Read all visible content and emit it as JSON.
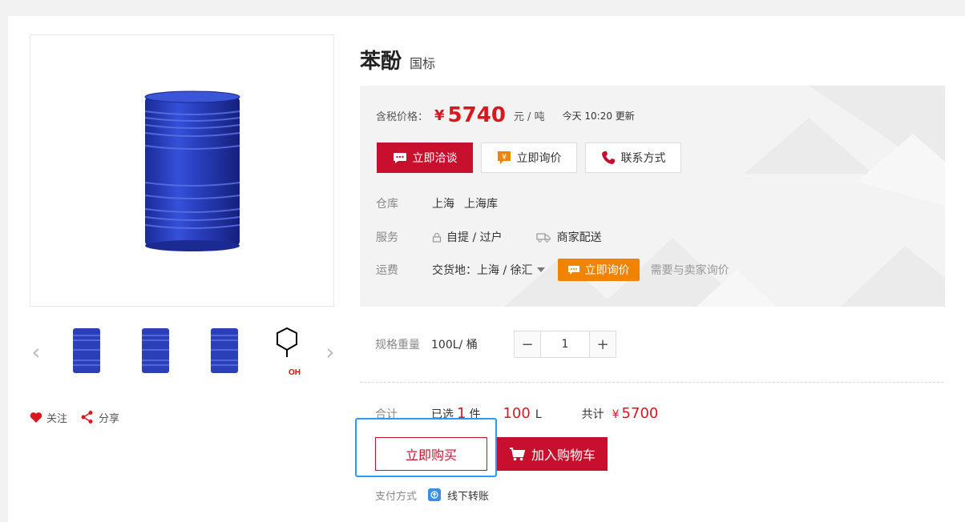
{
  "product": {
    "name": "苯酚",
    "standard": "国标"
  },
  "price": {
    "label": "含税价格：",
    "currency": "¥",
    "value": "5740",
    "unit": "元 / 吨",
    "update": "今天 10:20 更新"
  },
  "actions": {
    "negotiate": "立即洽谈",
    "inquire": "立即询价",
    "contact": "联系方式"
  },
  "warehouse": {
    "label": "仓库",
    "city": "上海",
    "name": "上海库"
  },
  "service": {
    "label": "服务",
    "pickup": "自提 / 过户",
    "delivery": "商家配送"
  },
  "freight": {
    "label": "运费",
    "delivery_place": "交货地：上海 / 徐汇",
    "inquire_btn": "立即询价",
    "note": "需要与卖家询价"
  },
  "spec": {
    "label": "规格重量",
    "value": "100L/ 桶",
    "quantity": "1"
  },
  "total": {
    "label": "合计",
    "selected_prefix": "已选",
    "selected_count": "1",
    "selected_suffix": "件",
    "volume": "100",
    "volume_unit": "L",
    "sum_label": "共计",
    "sum_currency": "¥",
    "sum_value": "5700"
  },
  "buttons": {
    "buy_now": "立即购买",
    "add_cart": "加入购物车"
  },
  "payment": {
    "label": "支付方式",
    "method": "线下转账"
  },
  "social": {
    "follow": "关注",
    "share": "分享"
  },
  "colors": {
    "brand_red": "#c8102e",
    "price_red": "#d9171f",
    "orange": "#f08300",
    "drum_blue": "#2b3fb8",
    "focus_blue": "#2d9bf0"
  }
}
